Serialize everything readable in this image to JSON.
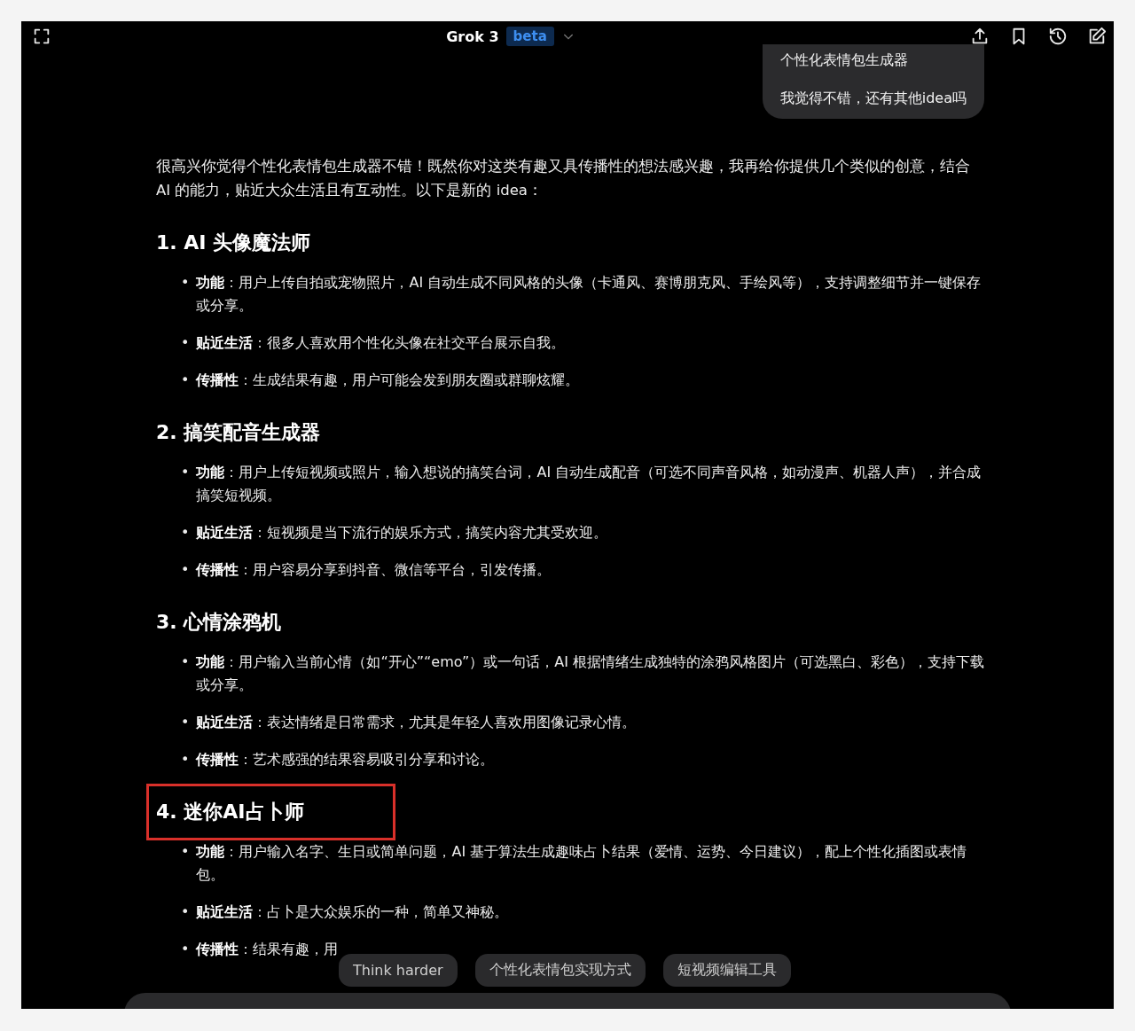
{
  "header": {
    "title": "Grok 3",
    "badge": "beta"
  },
  "user_message": [
    "个性化表情包生成器",
    "我觉得不错，还有其他idea吗"
  ],
  "reply": {
    "intro": "很高兴你觉得个性化表情包生成器不错！既然你对这类有趣又具传播性的想法感兴趣，我再给你提供几个类似的创意，结合 AI 的能力，贴近大众生活且有互动性。以下是新的 idea：",
    "sections": [
      {
        "title": "1. AI 头像魔法师",
        "highlighted": false,
        "bullets": [
          "**功能**：用户上传自拍或宠物照片，AI 自动生成不同风格的头像（卡通风、赛博朋克风、手绘风等），支持调整细节并一键保存或分享。",
          "**贴近生活**：很多人喜欢用个性化头像在社交平台展示自我。",
          "**传播性**：生成结果有趣，用户可能会发到朋友圈或群聊炫耀。"
        ]
      },
      {
        "title": "2. 搞笑配音生成器",
        "highlighted": false,
        "bullets": [
          "**功能**：用户上传短视频或照片，输入想说的搞笑台词，AI 自动生成配音（可选不同声音风格，如动漫声、机器人声），并合成搞笑短视频。",
          "**贴近生活**：短视频是当下流行的娱乐方式，搞笑内容尤其受欢迎。",
          "**传播性**：用户容易分享到抖音、微信等平台，引发传播。"
        ]
      },
      {
        "title": "3. 心情涂鸦机",
        "highlighted": false,
        "bullets": [
          "**功能**：用户输入当前心情（如“开心”“emo”）或一句话，AI 根据情绪生成独特的涂鸦风格图片（可选黑白、彩色），支持下载或分享。",
          "**贴近生活**：表达情绪是日常需求，尤其是年轻人喜欢用图像记录心情。",
          "**传播性**：艺术感强的结果容易吸引分享和讨论。"
        ]
      },
      {
        "title": "4. 迷你AI占卜师",
        "highlighted": true,
        "bullets": [
          "**功能**：用户输入名字、生日或简单问题，AI 基于算法生成趣味占卜结果（爱情、运势、今日建议），配上个性化插图或表情包。",
          "**贴近生活**：占卜是大众娱乐的一种，简单又神秘。",
          "**传播性**：结果有趣，用"
        ]
      }
    ]
  },
  "bullet_marker": "•",
  "suggestions": [
    "Think harder",
    "个性化表情包实现方式",
    "短视频编辑工具"
  ]
}
